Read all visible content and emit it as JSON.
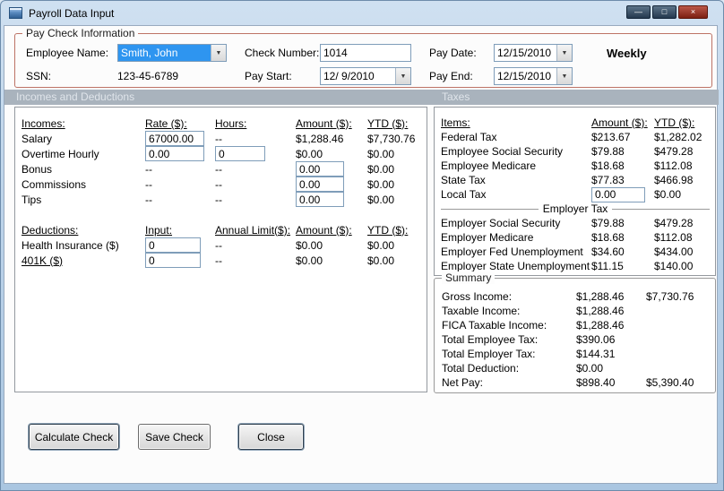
{
  "window": {
    "title": "Payroll Data Input"
  },
  "icons": {
    "dropdown": "▼",
    "minimize": "—",
    "maximize": "□",
    "close": "×"
  },
  "paycheck": {
    "group_label": "Pay Check Information",
    "employee_name": {
      "label": "Employee Name:",
      "value": "Smith, John"
    },
    "ssn": {
      "label": "SSN:",
      "value": "123-45-6789"
    },
    "check_number": {
      "label": "Check Number:",
      "value": "1014"
    },
    "pay_start": {
      "label": "Pay Start:",
      "value": "12/ 9/2010"
    },
    "pay_date": {
      "label": "Pay Date:",
      "value": "12/15/2010"
    },
    "pay_end": {
      "label": "Pay End:",
      "value": "12/15/2010"
    },
    "frequency": "Weekly"
  },
  "band": {
    "incomes": "Incomes and Deductions",
    "taxes": "Taxes"
  },
  "incomes": {
    "headers": [
      "Incomes:",
      "Rate ($):",
      "Hours:",
      "Amount ($):",
      "YTD ($):"
    ],
    "rows": [
      {
        "label": "Salary",
        "rate": "67000.00",
        "hours": "--",
        "amount": "$1,288.46",
        "ytd": "$7,730.76"
      },
      {
        "label": "Overtime Hourly",
        "rate": "0.00",
        "hours": "0",
        "amount": "$0.00",
        "ytd": "$0.00"
      },
      {
        "label": "Bonus",
        "rate": "--",
        "hours": "--",
        "amount": "0.00",
        "ytd": "$0.00"
      },
      {
        "label": "Commissions",
        "rate": "--",
        "hours": "--",
        "amount": "0.00",
        "ytd": "$0.00"
      },
      {
        "label": "Tips",
        "rate": "--",
        "hours": "--",
        "amount": "0.00",
        "ytd": "$0.00"
      }
    ]
  },
  "deductions": {
    "headers": [
      "Deductions:",
      "Input:",
      "Annual Limit($):",
      "Amount ($):",
      "YTD ($):"
    ],
    "rows": [
      {
        "label": "Health Insurance  ($)",
        "input": "0",
        "limit": "--",
        "amount": "$0.00",
        "ytd": "$0.00"
      },
      {
        "label": "401K  ($)",
        "input": "0",
        "limit": "--",
        "amount": "$0.00",
        "ytd": "$0.00"
      }
    ]
  },
  "taxes": {
    "headers": [
      "Items:",
      "Amount ($):",
      "YTD ($):"
    ],
    "employee_rows": [
      {
        "label": "Federal Tax",
        "amount": "$213.67",
        "ytd": "$1,282.02"
      },
      {
        "label": "Employee Social Security",
        "amount": "$79.88",
        "ytd": "$479.28"
      },
      {
        "label": "Employee Medicare",
        "amount": "$18.68",
        "ytd": "$112.08"
      },
      {
        "label": "State Tax",
        "amount": "$77.83",
        "ytd": "$466.98"
      },
      {
        "label": "Local Tax",
        "amount": "0.00",
        "ytd": "$0.00"
      }
    ],
    "employer_group_label": "Employer Tax",
    "employer_rows": [
      {
        "label": "Employer Social Security",
        "amount": "$79.88",
        "ytd": "$479.28"
      },
      {
        "label": "Employer Medicare",
        "amount": "$18.68",
        "ytd": "$112.08"
      },
      {
        "label": "Employer Fed Unemployment",
        "amount": "$34.60",
        "ytd": "$434.00"
      },
      {
        "label": "Employer State Unemployment",
        "amount": "$11.15",
        "ytd": "$140.00"
      }
    ]
  },
  "summary": {
    "group_label": "Summary",
    "rows": [
      {
        "label": "Gross Income:",
        "amount": "$1,288.46",
        "ytd": "$7,730.76"
      },
      {
        "label": "Taxable Income:",
        "amount": "$1,288.46",
        "ytd": ""
      },
      {
        "label": "FICA Taxable Income:",
        "amount": "$1,288.46",
        "ytd": ""
      },
      {
        "label": "Total Employee Tax:",
        "amount": "$390.06",
        "ytd": ""
      },
      {
        "label": "Total Employer Tax:",
        "amount": "$144.31",
        "ytd": ""
      },
      {
        "label": "Total Deduction:",
        "amount": "$0.00",
        "ytd": ""
      },
      {
        "label": "Net Pay:",
        "amount": "$898.40",
        "ytd": "$5,390.40"
      }
    ]
  },
  "buttons": {
    "calculate": "Calculate Check",
    "save": "Save Check",
    "close": "Close"
  },
  "colors": {
    "selection_blue": "#2e95f0",
    "group_border_red": "#bd7366",
    "band_gray": "#a9b3bd",
    "titlebar_blue": "#bdd4ea"
  }
}
